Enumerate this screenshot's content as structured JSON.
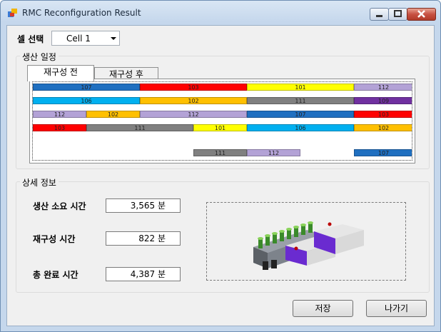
{
  "window": {
    "title": "RMC Reconfiguration Result"
  },
  "cell_select": {
    "label": "셀 선택",
    "value": "Cell 1"
  },
  "schedule": {
    "group_title": "생산 일정",
    "tabs": [
      {
        "label": "재구성 전"
      },
      {
        "label": "재구성 후"
      }
    ],
    "colors": {
      "blue": "#1f6fc0",
      "red": "#ff0000",
      "yellow": "#ffff00",
      "lavender": "#b3a2d6",
      "cyan": "#00b0f0",
      "orange": "#ffc000",
      "gray": "#808080",
      "purple": "#7030a0"
    },
    "rows": [
      [
        {
          "label": "107",
          "color": "blue"
        },
        {
          "label": "103",
          "color": "red"
        },
        {
          "label": "101",
          "color": "yellow"
        },
        {
          "label": "112",
          "color": "lavender"
        }
      ],
      [
        {
          "label": "106",
          "color": "cyan"
        },
        {
          "label": "102",
          "color": "orange"
        },
        {
          "label": "111",
          "color": "gray"
        },
        {
          "label": "109",
          "color": "purple"
        }
      ],
      [
        {
          "label": "112",
          "color": "lavender"
        },
        {
          "label": "102",
          "color": "orange"
        },
        {
          "label": "112",
          "color": "lavender"
        },
        {
          "label": "107",
          "color": "blue"
        },
        {
          "label": "103",
          "color": "red"
        }
      ],
      [
        {
          "label": "103",
          "color": "red"
        },
        {
          "label": "111",
          "color": "gray"
        },
        {
          "label": "101",
          "color": "yellow"
        },
        {
          "label": "106",
          "color": "cyan"
        },
        {
          "label": "102",
          "color": "orange"
        }
      ],
      [
        {
          "label": "111",
          "color": "gray"
        },
        {
          "label": "112",
          "color": "lavender"
        },
        {
          "label": "107",
          "color": "blue"
        }
      ]
    ]
  },
  "details": {
    "group_title": "상세 정보",
    "production_time": {
      "label": "생산 소요 시간",
      "value": "3,565 분"
    },
    "reconfig_time": {
      "label": "재구성 시간",
      "value": "822 분"
    },
    "total_time": {
      "label": "총 완료 시간",
      "value": "4,387 분"
    }
  },
  "buttons": {
    "save": "저장",
    "exit": "나가기"
  }
}
